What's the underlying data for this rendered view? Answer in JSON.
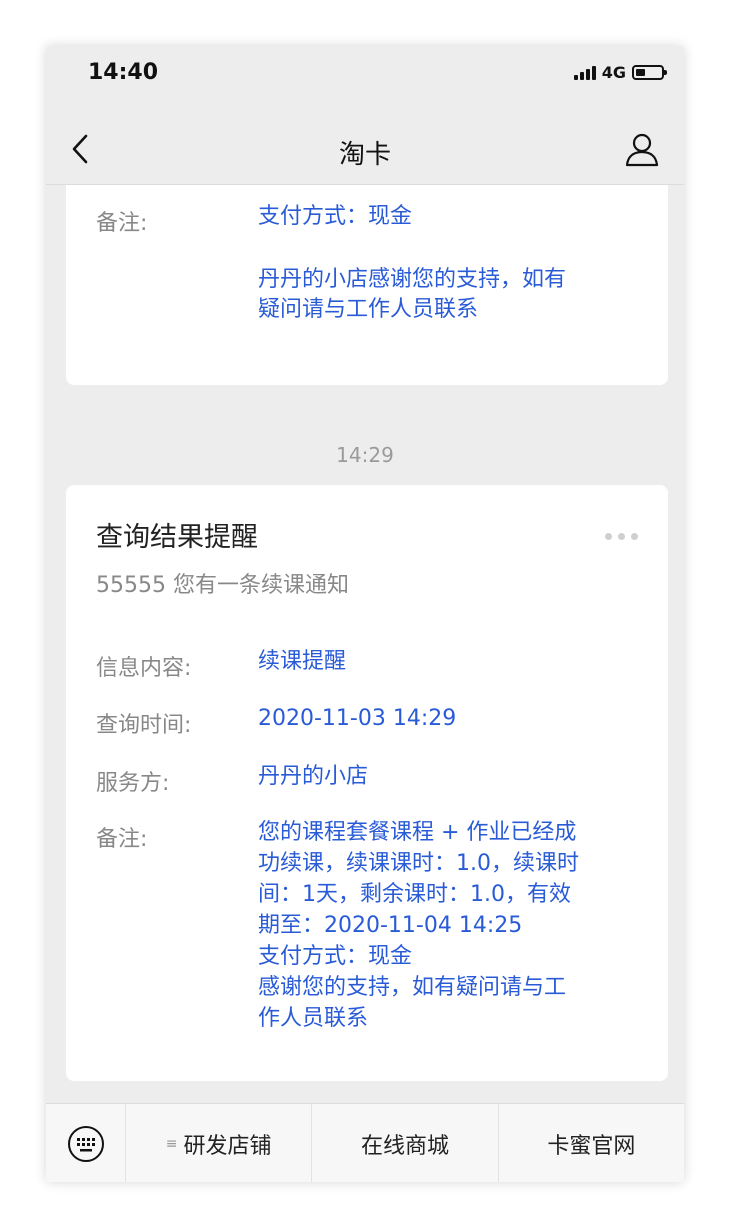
{
  "status_bar": {
    "time": "14:40",
    "network": "4G"
  },
  "nav": {
    "title": "淘卡"
  },
  "card_prev": {
    "remark_label": "备注:",
    "remark_line1": "支付方式：现金",
    "remark_line2": "丹丹的小店感谢您的支持，如有",
    "remark_line3": "疑问请与工作人员联系"
  },
  "timestamp": "14:29",
  "card_main": {
    "title": "查询结果提醒",
    "subtitle": "55555 您有一条续课通知",
    "fields": [
      {
        "label": "信息内容:",
        "value": "续课提醒"
      },
      {
        "label": "查询时间:",
        "value": "2020-11-03 14:29"
      },
      {
        "label": "服务方:",
        "value": "丹丹的小店"
      }
    ],
    "remark_label": "备注:",
    "remark_lines": [
      "您的课程套餐课程 + 作业已经成",
      "功续课，续课课时：1.0，续课时",
      "间：1天，剩余课时：1.0，有效",
      "期至：2020-11-04 14:25",
      "支付方式：现金",
      "感谢您的支持，如有疑问请与工",
      "作人员联系"
    ]
  },
  "menu": {
    "items": [
      {
        "prefix": "≡",
        "label": "研发店铺"
      },
      {
        "label": "在线商城"
      },
      {
        "label": "卡蜜官网"
      }
    ]
  },
  "colors": {
    "link_blue": "#2a5bd7",
    "label_gray": "#888888",
    "background": "#ededed"
  }
}
